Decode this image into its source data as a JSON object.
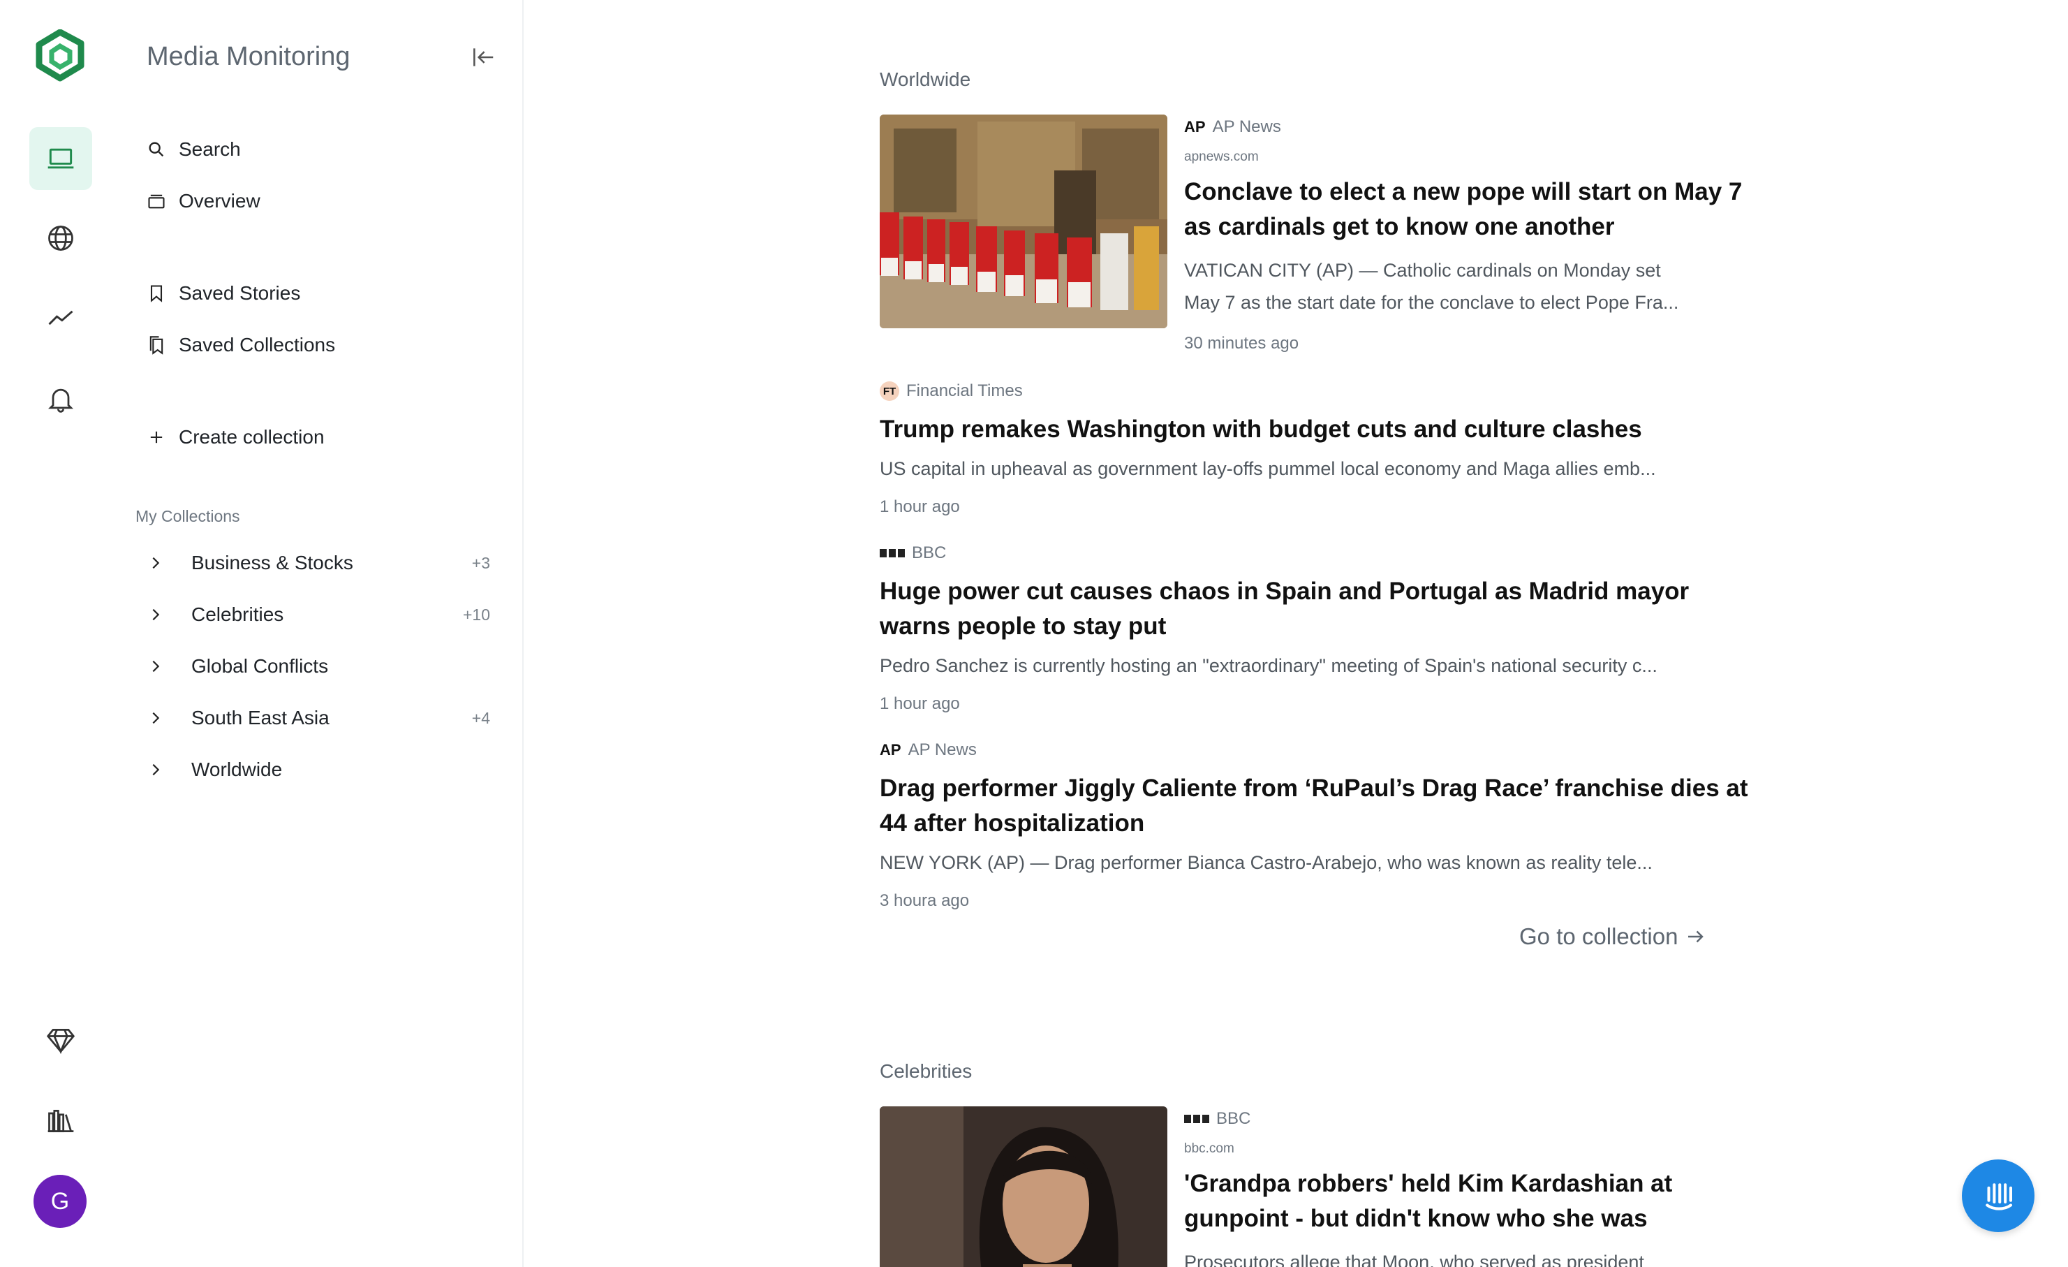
{
  "app": {
    "title": "Media Monitoring",
    "avatar_letter": "G"
  },
  "rail": {
    "icons": [
      "logo-icon",
      "laptop-icon",
      "globe-icon",
      "trend-icon",
      "bell-icon",
      "diamond-icon",
      "library-icon"
    ]
  },
  "sidebar": {
    "nav": [
      {
        "label": "Search",
        "icon": "search-icon"
      },
      {
        "label": "Overview",
        "icon": "overview-icon"
      },
      {
        "label": "Saved Stories",
        "icon": "bookmark-icon"
      },
      {
        "label": "Saved Collections",
        "icon": "bookmarks-icon"
      },
      {
        "label": "Create collection",
        "icon": "plus-icon"
      }
    ],
    "section_label": "My Collections",
    "collections": [
      {
        "label": "Business & Stocks",
        "count": "+3"
      },
      {
        "label": "Celebrities",
        "count": "+10"
      },
      {
        "label": "Global Conflicts",
        "count": ""
      },
      {
        "label": "South East Asia",
        "count": "+4"
      },
      {
        "label": "Worldwide",
        "count": ""
      }
    ]
  },
  "main": {
    "worldwide": {
      "heading": "Worldwide",
      "featured": {
        "source_mark": "AP",
        "source": "AP News",
        "domain": "apnews.com",
        "headline": "Conclave to elect a new pope will start on May 7 as cardinals get to know one another",
        "snippet_line1": "VATICAN CITY (AP) — Catholic cardinals on Monday set",
        "snippet_line2": "May 7 as the start date for the conclave to elect Pope Fra...",
        "time": "30 minutes ago"
      },
      "stories": [
        {
          "source_mark": "FT",
          "source": "Financial Times",
          "headline": "Trump remakes Washington with budget cuts and culture clashes",
          "snippet": "US capital in upheaval as government lay-offs pummel local economy and Maga allies emb...",
          "time": "1 hour ago"
        },
        {
          "source_mark": "BBC",
          "source": "BBC",
          "headline": "Huge power cut causes chaos in Spain and Portugal as Madrid mayor warns people to stay put",
          "snippet": "Pedro Sanchez is currently hosting an \"extraordinary\" meeting of Spain's national security c...",
          "time": "1 hour ago"
        },
        {
          "source_mark": "AP",
          "source": "AP News",
          "headline": "Drag performer Jiggly Caliente from ‘RuPaul’s Drag Race’ franchise dies at 44 after hospitalization",
          "snippet": "NEW YORK (AP) — Drag performer Bianca Castro-Arabejo, who was known as reality tele...",
          "time": "3 houra ago"
        }
      ],
      "goto_label": "Go to collection"
    },
    "celebrities": {
      "heading": "Celebrities",
      "featured": {
        "source": "BBC",
        "domain": "bbc.com",
        "headline": "'Grandpa robbers' held Kim Kardashian at gunpoint - but didn't know who she was",
        "snippet_line1": "Prosecutors allege that Moon, who served as president"
      }
    }
  },
  "colors": {
    "accent": "#1f8a4c",
    "active_bg": "#e3f6ef",
    "fab": "#1e88e5",
    "avatar": "#6a1fb8"
  }
}
